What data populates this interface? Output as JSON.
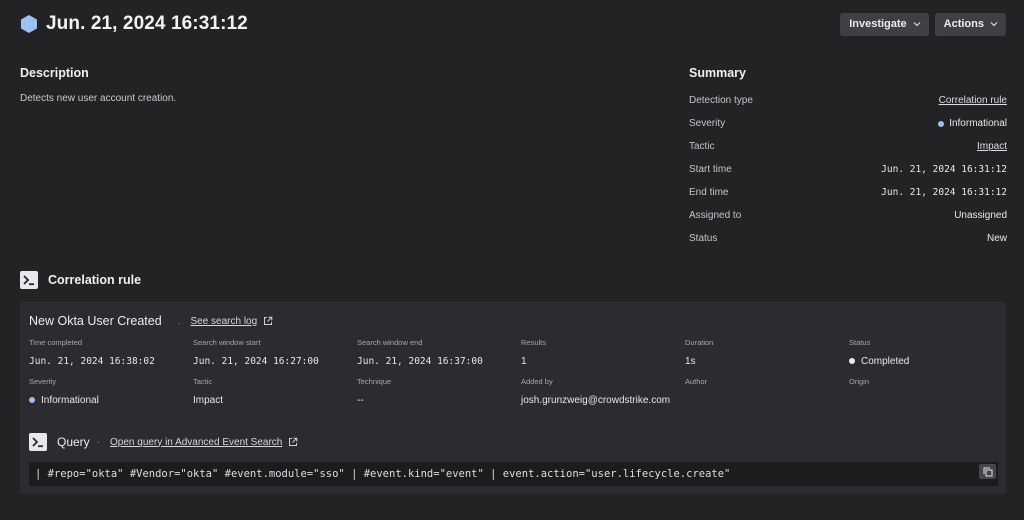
{
  "header": {
    "title": "Jun. 21, 2024 16:31:12",
    "investigate_label": "Investigate",
    "actions_label": "Actions"
  },
  "description": {
    "title": "Description",
    "text": "Detects new user account creation."
  },
  "summary": {
    "title": "Summary",
    "rows": [
      {
        "label": "Detection type",
        "value": "Correlation rule"
      },
      {
        "label": "Severity",
        "value": "Informational"
      },
      {
        "label": "Tactic",
        "value": "Impact"
      },
      {
        "label": "Start time",
        "value": "Jun. 21, 2024 16:31:12"
      },
      {
        "label": "End time",
        "value": "Jun. 21, 2024 16:31:12"
      },
      {
        "label": "Assigned to",
        "value": "Unassigned"
      },
      {
        "label": "Status",
        "value": "New"
      }
    ]
  },
  "correlation": {
    "title": "Correlation rule",
    "rule_name": "New Okta User Created",
    "separator": ".",
    "search_log_link": "See search log",
    "fields_row1": [
      {
        "label": "Time completed",
        "value": "Jun. 21, 2024 16:38:02"
      },
      {
        "label": "Search window start",
        "value": "Jun. 21, 2024 16:27:00"
      },
      {
        "label": "Search window end",
        "value": "Jun. 21, 2024 16:37:00"
      },
      {
        "label": "Results",
        "value": "1"
      },
      {
        "label": "Duration",
        "value": "1s"
      },
      {
        "label": "Status",
        "value": "Completed"
      }
    ],
    "fields_row2": [
      {
        "label": "Severity",
        "value": "Informational"
      },
      {
        "label": "Tactic",
        "value": "Impact"
      },
      {
        "label": "Technique",
        "value": "--"
      },
      {
        "label": "Added by",
        "value": "josh.grunzweig@crowdstrike.com"
      },
      {
        "label": "Author",
        "value": ""
      },
      {
        "label": "Origin",
        "value": ""
      }
    ],
    "query": {
      "title": "Query",
      "separator": "·",
      "link": "Open query in Advanced Event Search",
      "text": "| #repo=\"okta\" #Vendor=\"okta\" #event.module=\"sso\" | #event.kind=\"event\" | event.action=\"user.lifecycle.create\""
    }
  },
  "colors": {
    "background": "#232326",
    "card": "#2c2c30",
    "informational": "#9bbcf5",
    "completed": "#dcf5d6",
    "hexagon": "#9fbef2"
  }
}
